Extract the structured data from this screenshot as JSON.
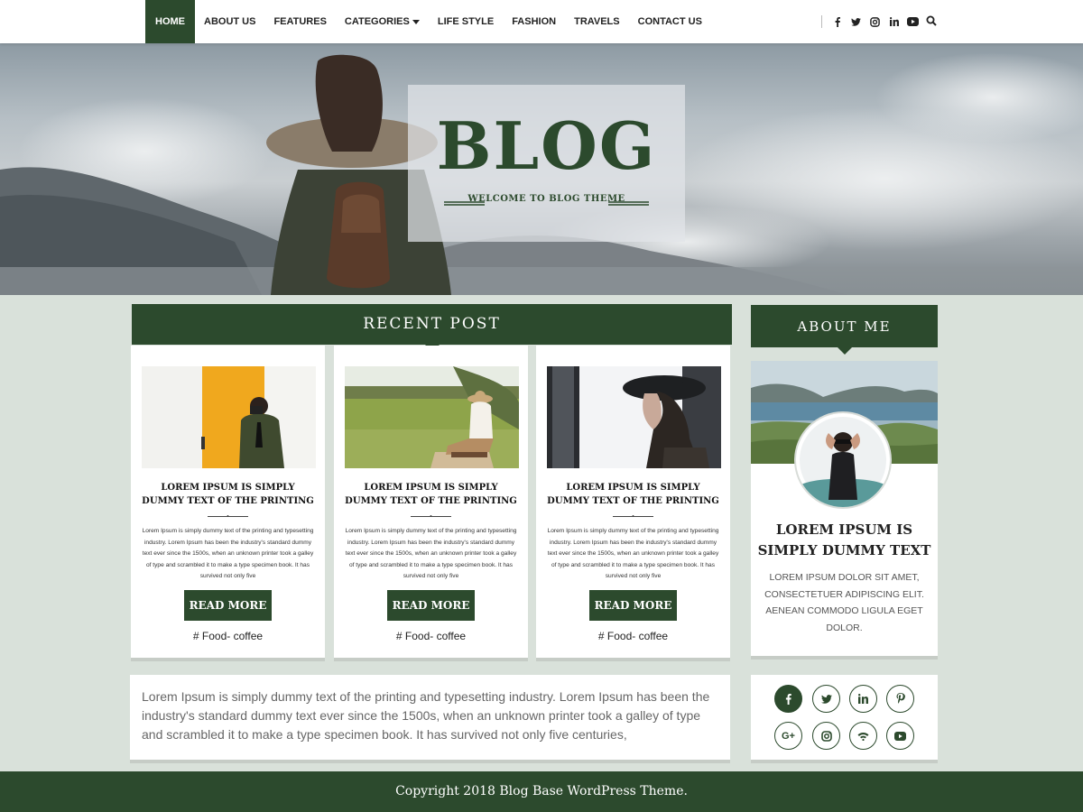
{
  "nav": {
    "items": [
      {
        "label": "HOME"
      },
      {
        "label": "ABOUT US"
      },
      {
        "label": "FEATURES"
      },
      {
        "label": "CATEGORIES"
      },
      {
        "label": "LIFE STYLE"
      },
      {
        "label": "FASHION"
      },
      {
        "label": "TRAVELS"
      },
      {
        "label": "CONTACT US"
      }
    ],
    "social_icons": [
      "facebook-icon",
      "twitter-icon",
      "instagram-icon",
      "linkedin-icon",
      "youtube-icon"
    ],
    "search_icon": "search-icon"
  },
  "hero": {
    "logo_title": "BLOG",
    "logo_tagline": "WELCOME TO BLOG THEME"
  },
  "recent": {
    "heading": "RECENT POST",
    "posts": [
      {
        "title": "LOREM IPSUM IS SIMPLY DUMMY TEXT OF THE PRINTING .",
        "excerpt": "Lorem Ipsum is simply dummy text of the printing and typesetting industry. Lorem Ipsum has been the industry's standard dummy text ever since the 1500s, when an unknown printer took a galley of type and scrambled it to make a type specimen book. It has survived not only five",
        "button": "READ MORE",
        "tag": "#  Food- coffee"
      },
      {
        "title": "LOREM IPSUM IS SIMPLY DUMMY TEXT OF THE PRINTING .",
        "excerpt": "Lorem Ipsum is simply dummy text of the printing and typesetting industry. Lorem Ipsum has been the industry's standard dummy text ever since the 1500s, when an unknown printer took a galley of type and scrambled it to make a type specimen book. It has survived not only five",
        "button": "READ MORE",
        "tag": "#  Food- coffee"
      },
      {
        "title": "LOREM IPSUM IS SIMPLY DUMMY TEXT OF THE PRINTING .",
        "excerpt": "Lorem Ipsum is simply dummy text of the printing and typesetting industry. Lorem Ipsum has been the industry's standard dummy text ever since the 1500s, when an unknown printer took a galley of type and scrambled it to make a type specimen book. It has survived not only five",
        "button": "READ MORE",
        "tag": "#  Food- coffee"
      }
    ],
    "body_text": "Lorem Ipsum is simply dummy text of the printing and typesetting industry. Lorem Ipsum has been the industry's standard dummy text ever since the 1500s, when an unknown printer took a galley of type and scrambled it to make a type specimen book. It has survived not only five centuries,"
  },
  "about": {
    "heading": "ABOUT ME",
    "name": "LOREM IPSUM IS SIMPLY DUMMY TEXT",
    "description": "LOREM IPSUM DOLOR SIT AMET, CONSECTETUER ADIPISCING ELIT. AENEAN COMMODO LIGULA EGET DOLOR."
  },
  "social_links": [
    "facebook-icon",
    "twitter-icon",
    "linkedin-icon",
    "pinterest-icon",
    "google-plus-icon",
    "instagram-icon",
    "wifi-icon",
    "youtube-icon"
  ],
  "footer": {
    "copyright": "Copyright 2018 Blog Base WordPress Theme."
  },
  "colors": {
    "brand_green": "#2c4a2d",
    "page_background": "#d9e1da"
  }
}
